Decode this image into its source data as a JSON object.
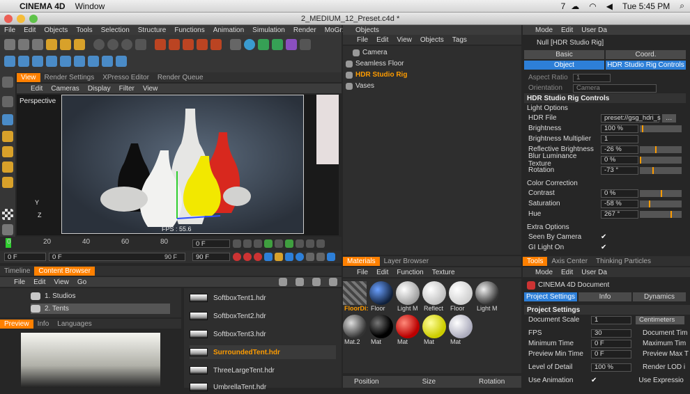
{
  "mac": {
    "app": "CINEMA 4D",
    "menu": "Window",
    "status_num": "7",
    "clock": "Tue 5:45 PM"
  },
  "window": {
    "title": "2_MEDIUM_12_Preset.c4d *"
  },
  "main_menu": [
    "File",
    "Edit",
    "Objects",
    "Tools",
    "Selection",
    "Structure",
    "Functions",
    "Animation",
    "Simulation",
    "Render",
    "MoGr:"
  ],
  "viewport": {
    "tabs": [
      "View",
      "Render Settings",
      "XPresso Editor",
      "Render Queue"
    ],
    "menu": [
      "Edit",
      "Cameras",
      "Display",
      "Filter",
      "View"
    ],
    "label": "Perspective",
    "fps": "FPS : 55.6",
    "axis_y": "Y",
    "axis_z": "Z"
  },
  "timeline": {
    "ticks": [
      "0",
      "20",
      "40",
      "60",
      "80"
    ],
    "frame_start": "0 F",
    "frame_cur": "0 F",
    "frame_end": "90 F",
    "frame_end2": "90 F",
    "frame_field": "0 F"
  },
  "browser": {
    "tabs": [
      "Timeline",
      "Content Browser"
    ],
    "menu": [
      "File",
      "Edit",
      "View",
      "Go"
    ],
    "tree": [
      "1. Studios",
      "2. Tents"
    ],
    "preview_tabs": [
      "Preview",
      "Info",
      "Languages"
    ],
    "files": [
      "SoftboxTent1.hdr",
      "SoftboxTent2.hdr",
      "SoftboxTent3.hdr",
      "SurroundedTent.hdr",
      "ThreeLargeTent.hdr",
      "UmbrellaTent.hdr"
    ]
  },
  "objects": {
    "title": "Objects",
    "menu": [
      "File",
      "Edit",
      "View",
      "Objects",
      "Tags"
    ],
    "items": [
      "Camera",
      "Seamless Floor",
      "HDR Studio Rig",
      "Vases"
    ]
  },
  "materials": {
    "tabs": [
      "Materials",
      "Layer Browser"
    ],
    "menu": [
      "File",
      "Edit",
      "Function",
      "Texture"
    ],
    "row1": [
      "FloorDi:",
      "Floor",
      "Light M",
      "Reflect",
      "Floor",
      "Light M"
    ],
    "row2": [
      "Mat.2",
      "Mat",
      "Mat",
      "Mat",
      "Mat"
    ],
    "footer": [
      "Position",
      "Size",
      "Rotation"
    ]
  },
  "attributes": {
    "menu": [
      "Mode",
      "Edit",
      "User Da"
    ],
    "title": "Null [HDR Studio Rig]",
    "tabs1": [
      "Basic",
      "Coord."
    ],
    "tabs2": [
      "Object",
      "HDR Studio Rig Controls"
    ],
    "aspect_label": "Aspect Ratio",
    "aspect_val": "1",
    "orient_label": "Orientation",
    "orient_val": "Camera",
    "section": "HDR Studio Rig Controls",
    "light_options": "Light Options",
    "hdr_file_label": "HDR File",
    "hdr_file_val": "preset://gsg_hdri_s",
    "brightness_label": "Brightness",
    "brightness_val": "100 %",
    "brightness_level": 0.05,
    "bmult_label": "Brightness Multiplier",
    "bmult_val": "1",
    "refl_label": "Reflective Brightness",
    "refl_val": "-26 %",
    "refl_level": 0.37,
    "blur_label": "Blur Luminance Texture",
    "blur_val": "0 %",
    "blur_level": 0.0,
    "rot_label": "Rotation",
    "rot_val": "-73 °",
    "rot_level": 0.3,
    "color_correction": "Color Correction",
    "contrast_label": "Contrast",
    "contrast_val": "0 %",
    "contrast_level": 0.5,
    "sat_label": "Saturation",
    "sat_val": "-58 %",
    "sat_level": 0.21,
    "hue_label": "Hue",
    "hue_val": "267 °",
    "hue_level": 0.74,
    "extra_options": "Extra Options",
    "seen_label": "Seen By Camera",
    "gi_label": "GI Light On"
  },
  "tools": {
    "tabs": [
      "Tools",
      "Axis Center",
      "Thinking Particles"
    ],
    "menu": [
      "Mode",
      "Edit",
      "User Da"
    ],
    "doc": "CINEMA 4D Document",
    "tabs2": [
      "Project Settings",
      "Info",
      "Dynamics"
    ],
    "section": "Project Settings",
    "scale_label": "Document Scale",
    "scale_val": "1",
    "scale_unit": "Centimeters",
    "fps_label": "FPS",
    "fps_val": "30",
    "doc_time_label": "Document Tim",
    "min_label": "Minimum Time",
    "min_val": "0 F",
    "max_label": "Maximum Tim",
    "pmin_label": "Preview Min Time",
    "pmin_val": "0 F",
    "pmax_label": "Preview Max T",
    "lod_label": "Level of Detail",
    "lod_val": "100 %",
    "rlod_label": "Render LOD i",
    "anim_label": "Use Animation",
    "expr_label": "Use Expressio"
  }
}
